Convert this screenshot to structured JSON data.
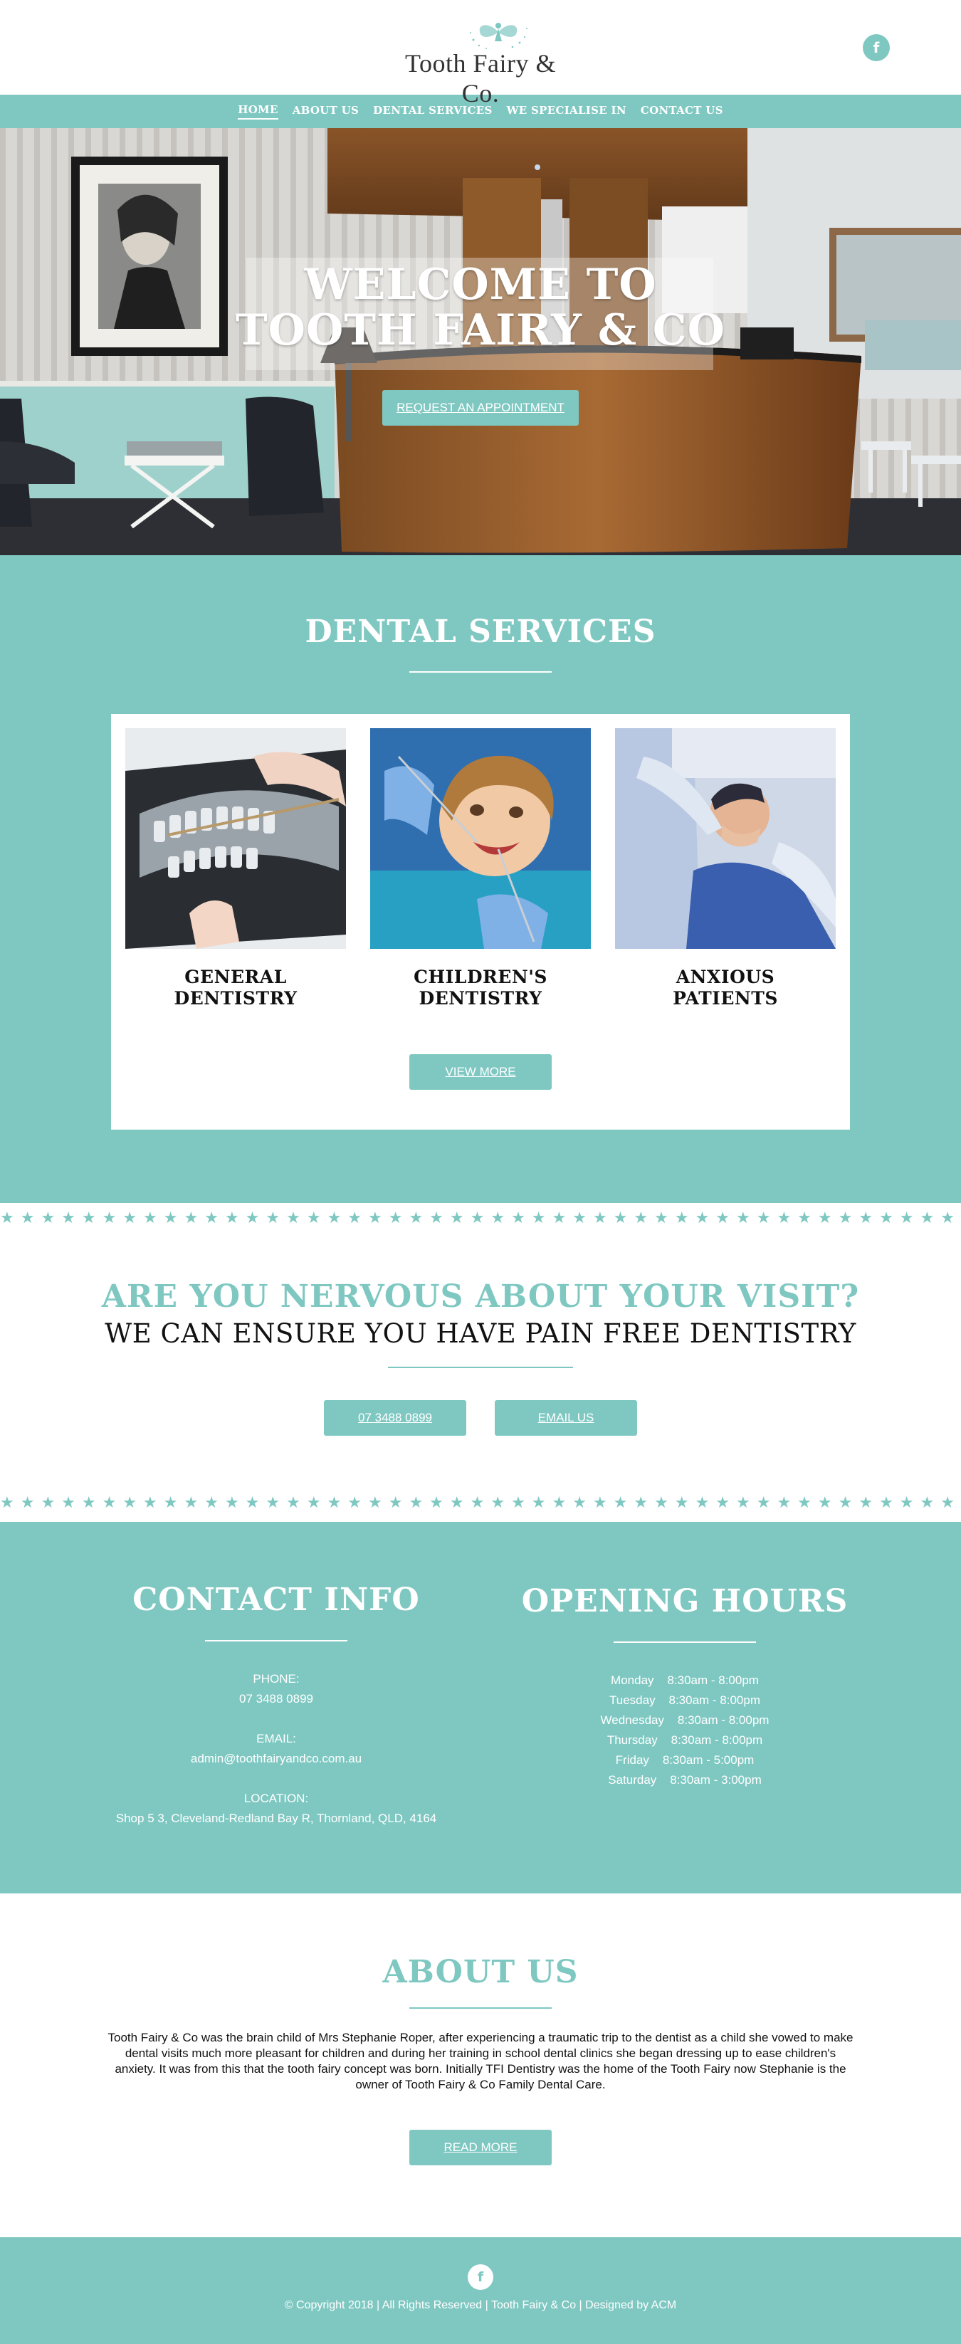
{
  "header": {
    "logo_text": "Tooth Fairy & Co.",
    "social_icon": "facebook-icon",
    "social_glyph": "f"
  },
  "nav": {
    "items": [
      {
        "label": "HOME",
        "active": true
      },
      {
        "label": "ABOUT US",
        "active": false
      },
      {
        "label": "DENTAL SERVICES",
        "active": false
      },
      {
        "label": "WE SPECIALISE IN",
        "active": false
      },
      {
        "label": "CONTACT US",
        "active": false
      }
    ]
  },
  "hero": {
    "title_line1": "WELCOME TO",
    "title_line2": "TOOTH FAIRY & CO",
    "button_label": "REQUEST AN APPOINTMENT"
  },
  "services": {
    "title": "DENTAL SERVICES",
    "items": [
      {
        "line1": "GENERAL",
        "line2": "DENTISTRY",
        "image": "x-ray-photo"
      },
      {
        "line1": "CHILDREN'S",
        "line2": "DENTISTRY",
        "image": "child-patient-photo"
      },
      {
        "line1": "ANXIOUS",
        "line2": "PATIENTS",
        "image": "anxious-patient-photo"
      }
    ],
    "button_label": "VIEW MORE"
  },
  "nervous": {
    "title": "ARE YOU NERVOUS ABOUT YOUR VISIT?",
    "subtitle": "WE CAN ENSURE YOU HAVE PAIN FREE DENTISTRY",
    "phone_button": "07 3488 0899",
    "email_button": "EMAIL US"
  },
  "contact": {
    "title": "CONTACT INFO",
    "phone_label": "PHONE:",
    "phone_value": "07 3488 0899",
    "email_label": "EMAIL:",
    "email_value": "admin@toothfairyandco.com.au",
    "location_label": "LOCATION:",
    "location_value": "Shop 5 3, Cleveland-Redland Bay R, Thornland, QLD, 4164"
  },
  "hours": {
    "title": "OPENING HOURS",
    "rows": [
      {
        "day": "Monday",
        "time": "8:30am - 8:00pm"
      },
      {
        "day": "Tuesday",
        "time": "8:30am - 8:00pm"
      },
      {
        "day": "Wednesday",
        "time": "8:30am - 8:00pm"
      },
      {
        "day": "Thursday",
        "time": "8:30am - 8:00pm"
      },
      {
        "day": "Friday",
        "time": "8:30am - 5:00pm"
      },
      {
        "day": "Saturday",
        "time": "8:30am - 3:00pm"
      }
    ]
  },
  "about": {
    "title": "ABOUT US",
    "text": "Tooth Fairy & Co was the brain child of Mrs Stephanie Roper, after experiencing a traumatic trip to the dentist as a child she vowed to make dental visits much more pleasant for children and during her training in school dental clinics she began dressing up to ease children's anxiety. It was from this that the tooth fairy concept was born. Initially TFI Dentistry was the home of the Tooth Fairy now Stephanie is the owner of Tooth Fairy & Co Family Dental Care.",
    "button_label": "READ MORE"
  },
  "footer": {
    "social_icon": "facebook-icon",
    "social_glyph": "f",
    "copyright": "© Copyright 2018 | All Rights Reserved | Tooth Fairy & Co | Designed by ACM"
  },
  "colors": {
    "accent": "#7fc8c2",
    "text_dark": "#111111",
    "white": "#ffffff"
  },
  "decorations": {
    "star_glyph": "★"
  }
}
